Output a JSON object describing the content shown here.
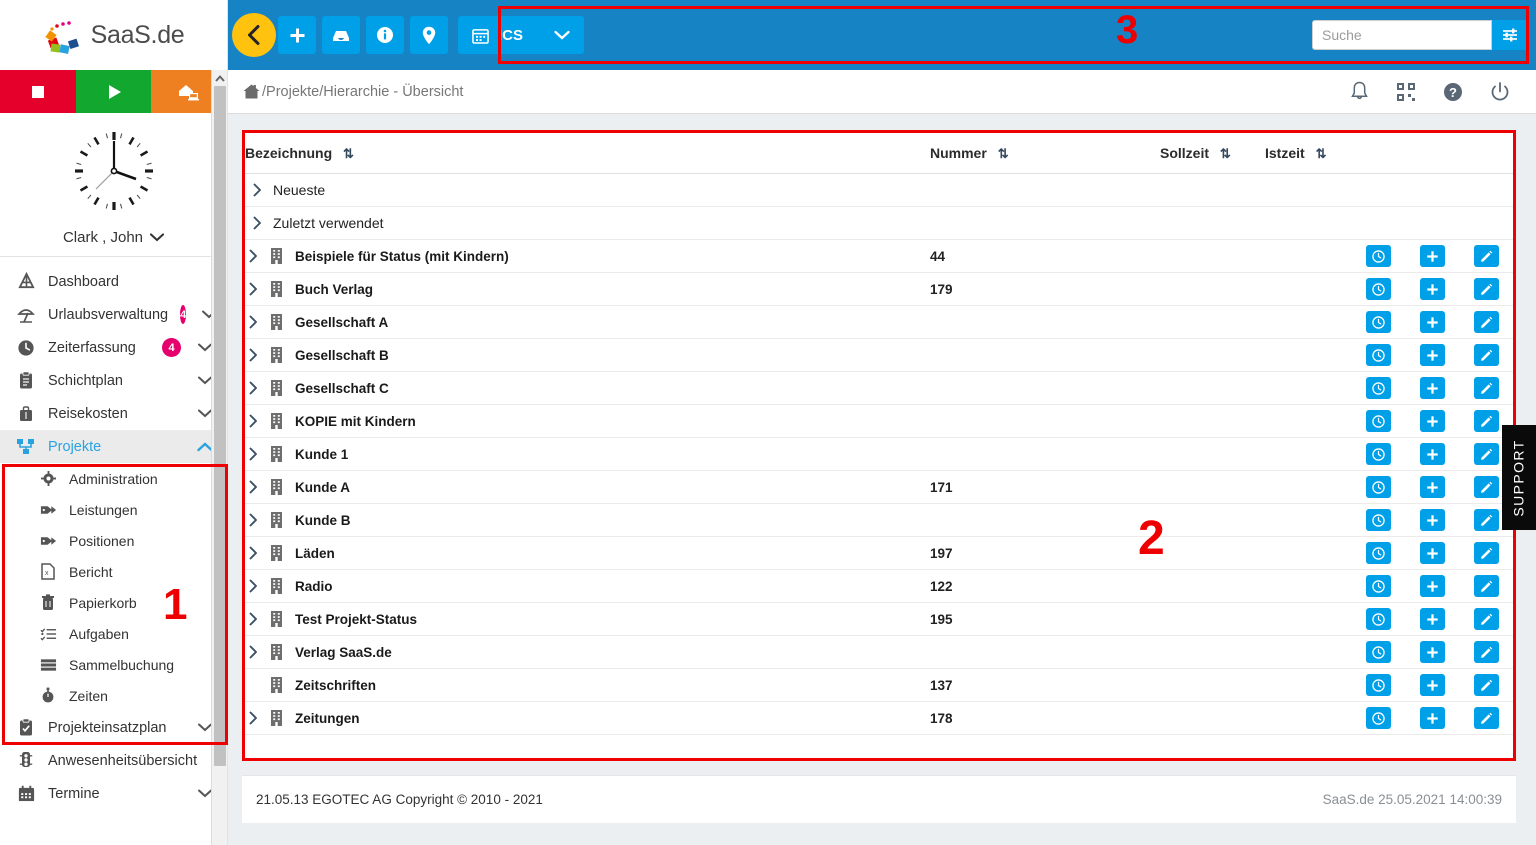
{
  "brand": {
    "name": "SaaS.de"
  },
  "collapse": {
    "icon": "chevron-left-icon"
  },
  "status_buttons": [
    {
      "name": "stop-button",
      "icon": "stop-square-icon",
      "color": "#e4002b"
    },
    {
      "name": "play-button",
      "icon": "play-triangle-icon",
      "color": "#12a830"
    },
    {
      "name": "home-office-button",
      "icon": "home-office-icon",
      "color": "#ef8022"
    }
  ],
  "user": {
    "name": "Clark , John",
    "caret": "chevron-down-icon"
  },
  "sidebar": {
    "items": [
      {
        "label": "Dashboard",
        "icon": "dashboard-icon",
        "badge": "",
        "chevron": "",
        "active": false
      },
      {
        "label": "Urlaubsverwaltung",
        "icon": "beach-umbrella-icon",
        "badge": "4",
        "chevron": "down",
        "active": false
      },
      {
        "label": "Zeiterfassung",
        "icon": "clock-icon",
        "badge": "4",
        "chevron": "down",
        "active": false
      },
      {
        "label": "Schichtplan",
        "icon": "clipboard-icon",
        "badge": "",
        "chevron": "down",
        "active": false
      },
      {
        "label": "Reisekosten",
        "icon": "suitcase-icon",
        "badge": "",
        "chevron": "down",
        "active": false
      },
      {
        "label": "Projekte",
        "icon": "project-tree-icon",
        "badge": "",
        "chevron": "up",
        "active": true
      }
    ],
    "projekte_sub": [
      {
        "label": "Administration",
        "icon": "gear-icon"
      },
      {
        "label": "Leistungen",
        "icon": "tag-icon"
      },
      {
        "label": "Positionen",
        "icon": "tag-icon"
      },
      {
        "label": "Bericht",
        "icon": "excel-report-icon"
      },
      {
        "label": "Papierkorb",
        "icon": "trash-icon"
      },
      {
        "label": "Aufgaben",
        "icon": "task-list-icon"
      },
      {
        "label": "Sammelbuchung",
        "icon": "server-stack-icon"
      },
      {
        "label": "Zeiten",
        "icon": "stopwatch-icon"
      }
    ],
    "items_after": [
      {
        "label": "Projekteinsatzplan",
        "icon": "clipboard-check-icon",
        "badge": "",
        "chevron": "down",
        "active": false
      },
      {
        "label": "Anwesenheitsübersicht",
        "icon": "traffic-light-icon",
        "badge": "",
        "chevron": "",
        "active": false
      },
      {
        "label": "Termine",
        "icon": "calendar-icon",
        "badge": "",
        "chevron": "down",
        "active": false
      }
    ]
  },
  "toolbar": {
    "buttons": [
      {
        "name": "add-button",
        "icon": "plus-icon"
      },
      {
        "name": "inbox-button",
        "icon": "inbox-icon"
      },
      {
        "name": "info-button",
        "icon": "info-circle-icon"
      },
      {
        "name": "location-button",
        "icon": "map-pin-icon"
      }
    ],
    "ics": {
      "label": "ICS",
      "icon": "calendar-icon",
      "caret": "chevron-down-icon"
    },
    "accent_color": "#00a0e9",
    "bar_color": "#1583c4"
  },
  "search": {
    "placeholder": "Suche",
    "value": "",
    "filter_icon": "sliders-icon"
  },
  "breadcrumb": {
    "home_icon": "home-icon",
    "path": "/Projekte/Hierarchie - Übersicht"
  },
  "header_icons": [
    {
      "name": "notifications-icon",
      "glyph": "bell-icon"
    },
    {
      "name": "qr-code-icon",
      "glyph": "qr-icon"
    },
    {
      "name": "help-icon",
      "glyph": "question-circle-icon"
    },
    {
      "name": "logout-icon",
      "glyph": "power-icon"
    }
  ],
  "table": {
    "columns": [
      {
        "key": "bezeichnung",
        "label": "Bezeichnung",
        "sortable": true
      },
      {
        "key": "nummer",
        "label": "Nummer",
        "sortable": true
      },
      {
        "key": "sollzeit",
        "label": "Sollzeit",
        "sortable": true
      },
      {
        "key": "istzeit",
        "label": "Istzeit",
        "sortable": true
      }
    ],
    "sort_icon": "sort-updown-icon",
    "group_rows": [
      {
        "label": "Neueste",
        "expandable": true
      },
      {
        "label": "Zuletzt verwendet",
        "expandable": true
      }
    ],
    "rows": [
      {
        "bezeichnung": "Beispiele für Status (mit Kindern)",
        "nummer": "44",
        "sollzeit": "",
        "istzeit": "",
        "expandable": true,
        "icon": "building-icon"
      },
      {
        "bezeichnung": "Buch Verlag",
        "nummer": "179",
        "sollzeit": "",
        "istzeit": "",
        "expandable": true,
        "icon": "building-icon"
      },
      {
        "bezeichnung": "Gesellschaft A",
        "nummer": "",
        "sollzeit": "",
        "istzeit": "",
        "expandable": true,
        "icon": "building-icon"
      },
      {
        "bezeichnung": "Gesellschaft B",
        "nummer": "",
        "sollzeit": "",
        "istzeit": "",
        "expandable": true,
        "icon": "building-icon"
      },
      {
        "bezeichnung": "Gesellschaft C",
        "nummer": "",
        "sollzeit": "",
        "istzeit": "",
        "expandable": true,
        "icon": "building-icon"
      },
      {
        "bezeichnung": "KOPIE mit Kindern",
        "nummer": "",
        "sollzeit": "",
        "istzeit": "",
        "expandable": true,
        "icon": "building-icon"
      },
      {
        "bezeichnung": "Kunde 1",
        "nummer": "",
        "sollzeit": "",
        "istzeit": "",
        "expandable": true,
        "icon": "building-icon"
      },
      {
        "bezeichnung": "Kunde A",
        "nummer": "171",
        "sollzeit": "",
        "istzeit": "",
        "expandable": true,
        "icon": "building-icon"
      },
      {
        "bezeichnung": "Kunde B",
        "nummer": "",
        "sollzeit": "",
        "istzeit": "",
        "expandable": true,
        "icon": "building-icon"
      },
      {
        "bezeichnung": "Läden",
        "nummer": "197",
        "sollzeit": "",
        "istzeit": "",
        "expandable": true,
        "icon": "building-icon"
      },
      {
        "bezeichnung": "Radio",
        "nummer": "122",
        "sollzeit": "",
        "istzeit": "",
        "expandable": true,
        "icon": "building-icon"
      },
      {
        "bezeichnung": "Test Projekt-Status",
        "nummer": "195",
        "sollzeit": "",
        "istzeit": "",
        "expandable": true,
        "icon": "building-icon"
      },
      {
        "bezeichnung": "Verlag SaaS.de",
        "nummer": "",
        "sollzeit": "",
        "istzeit": "",
        "expandable": true,
        "icon": "building-icon"
      },
      {
        "bezeichnung": "Zeitschriften",
        "nummer": "137",
        "sollzeit": "",
        "istzeit": "",
        "expandable": false,
        "icon": "building-icon"
      },
      {
        "bezeichnung": "Zeitungen",
        "nummer": "178",
        "sollzeit": "",
        "istzeit": "",
        "expandable": true,
        "icon": "building-icon"
      }
    ],
    "row_actions": [
      {
        "name": "book-time-button",
        "icon": "clock-icon"
      },
      {
        "name": "add-child-button",
        "icon": "plus-icon"
      },
      {
        "name": "edit-button",
        "icon": "pencil-icon"
      }
    ]
  },
  "footer": {
    "left": "21.05.13 EGOTEC AG Copyright © 2010 - 2021",
    "right_brand": "SaaS.de",
    "right_datetime": "25.05.2021 14:00:39"
  },
  "support_tab": {
    "label": "SUPPORT"
  },
  "annotations": [
    {
      "id": "1",
      "label": "1",
      "target": "projekte-sidebar-group"
    },
    {
      "id": "2",
      "label": "2",
      "target": "project-table"
    },
    {
      "id": "3",
      "label": "3",
      "target": "top-toolbar"
    }
  ]
}
